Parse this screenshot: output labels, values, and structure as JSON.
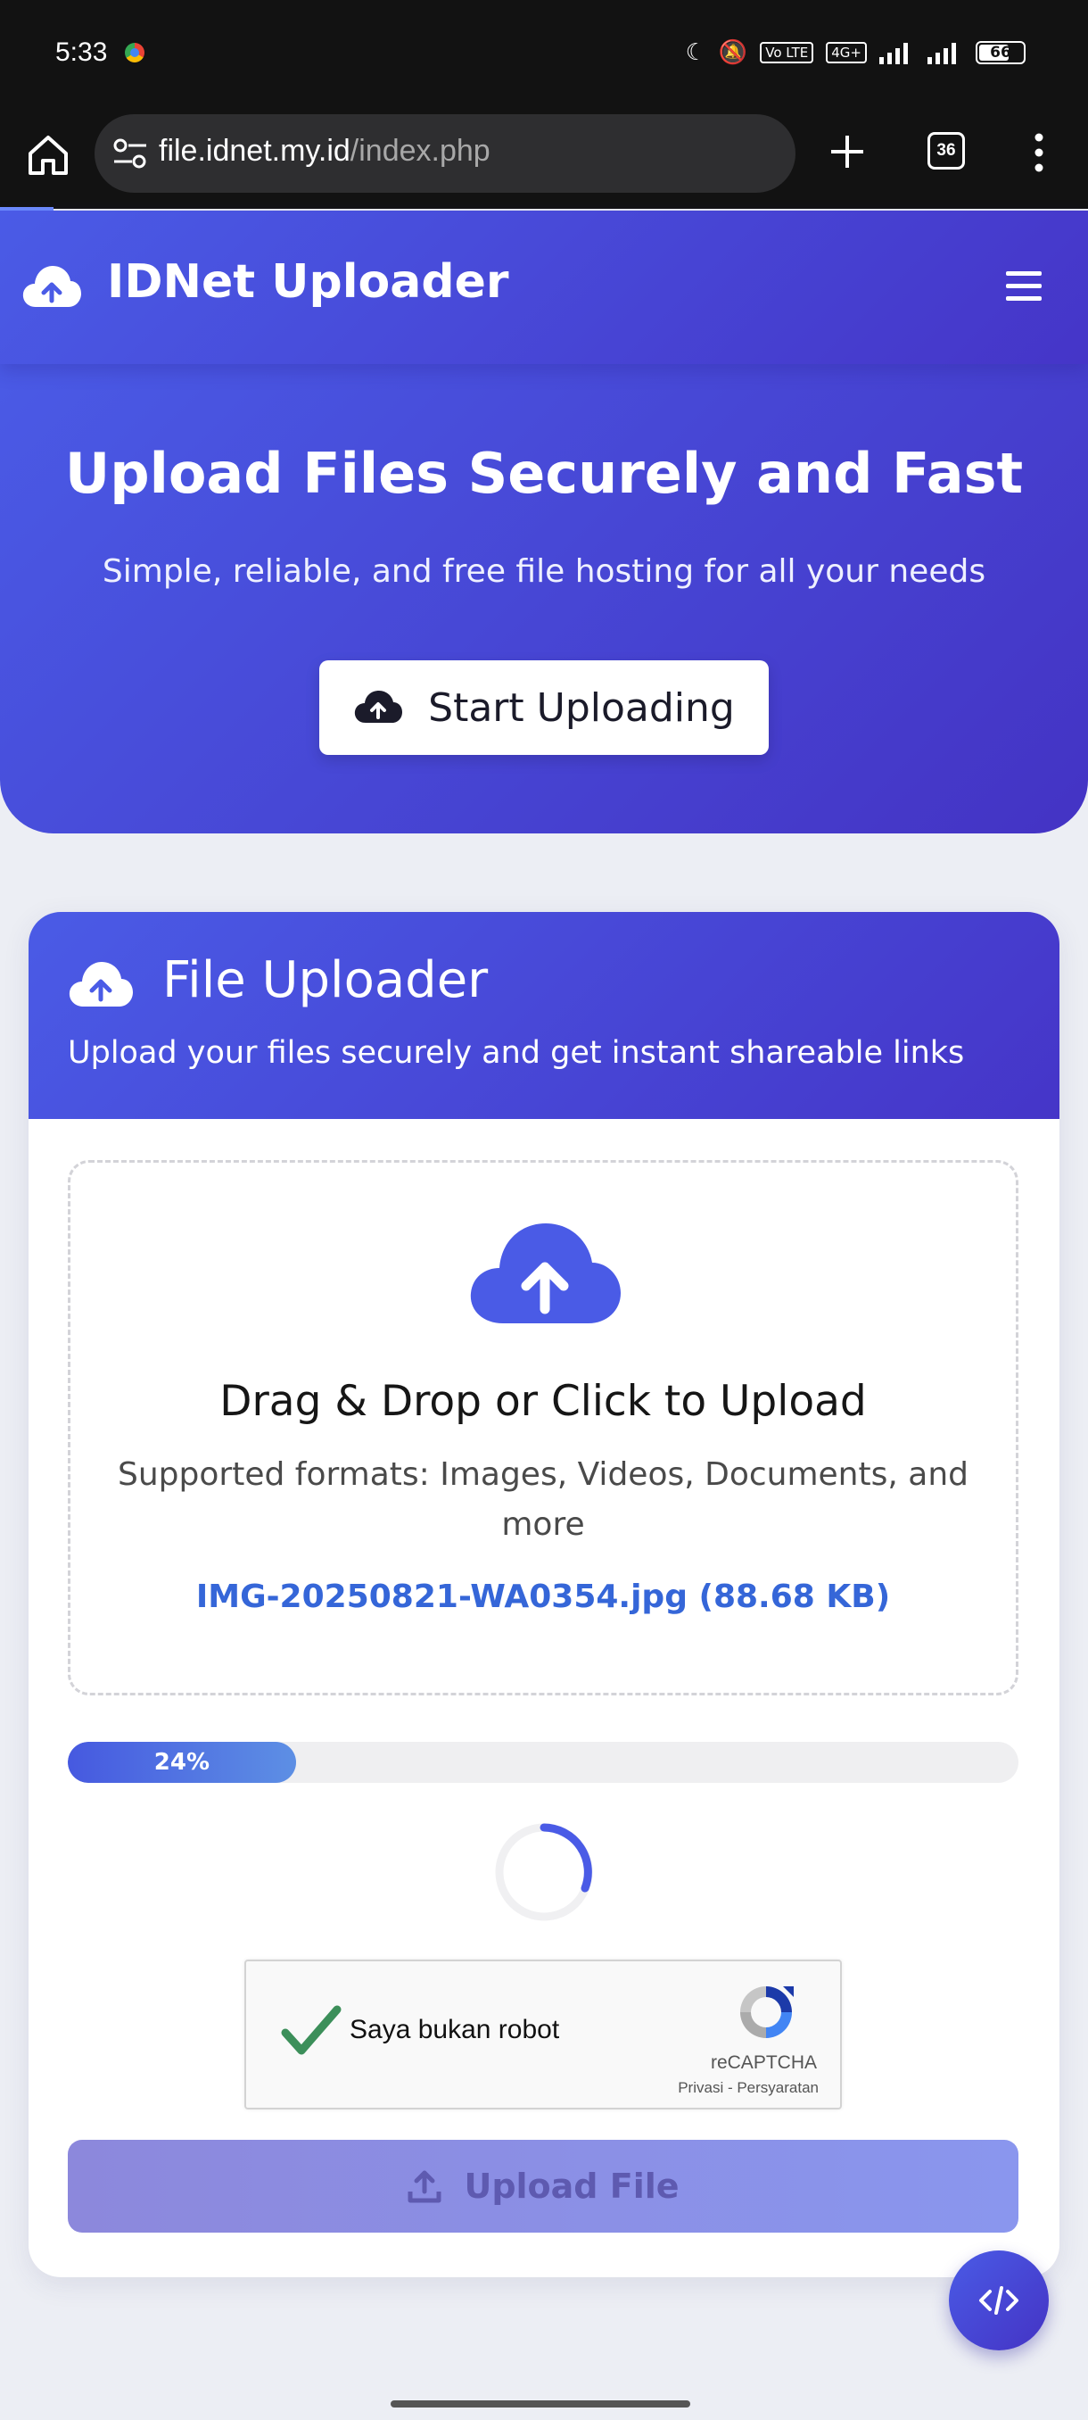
{
  "status_bar": {
    "time": "5:33",
    "network_badge": "Vo LTE",
    "network_type": "4G+",
    "battery": "66"
  },
  "browser": {
    "url_host": "file.idnet.my.id",
    "url_path": "/index.php",
    "tab_count": "36"
  },
  "header": {
    "brand": "IDNet Uploader"
  },
  "hero": {
    "title": "Upload Files Securely and Fast",
    "subtitle": "Simple, reliable, and free file hosting for all your needs",
    "cta_label": "Start Uploading"
  },
  "uploader": {
    "title": "File Uploader",
    "subtitle": "Upload your files securely and get instant shareable links",
    "dropzone_title": "Drag & Drop or Click to Upload",
    "supported_formats": "Supported formats: Images, Videos, Documents, and more",
    "selected_file": "IMG-20250821-WA0354.jpg (88.68 KB)",
    "progress_label": "24%",
    "progress_fraction": 0.24,
    "upload_button_label": "Upload File"
  },
  "recaptcha": {
    "label": "Saya bukan robot",
    "brand": "reCAPTCHA",
    "links": "Privasi - Persyaratan",
    "checked": true
  },
  "colors": {
    "primary": "#4a5be6",
    "primary_dark": "#4433c4",
    "file_link": "#3566d8",
    "check_green": "#3c8f5a"
  },
  "icons": {
    "brand": "cloud-upload-icon",
    "hamburger": "menu-icon",
    "fab": "code-icon"
  }
}
